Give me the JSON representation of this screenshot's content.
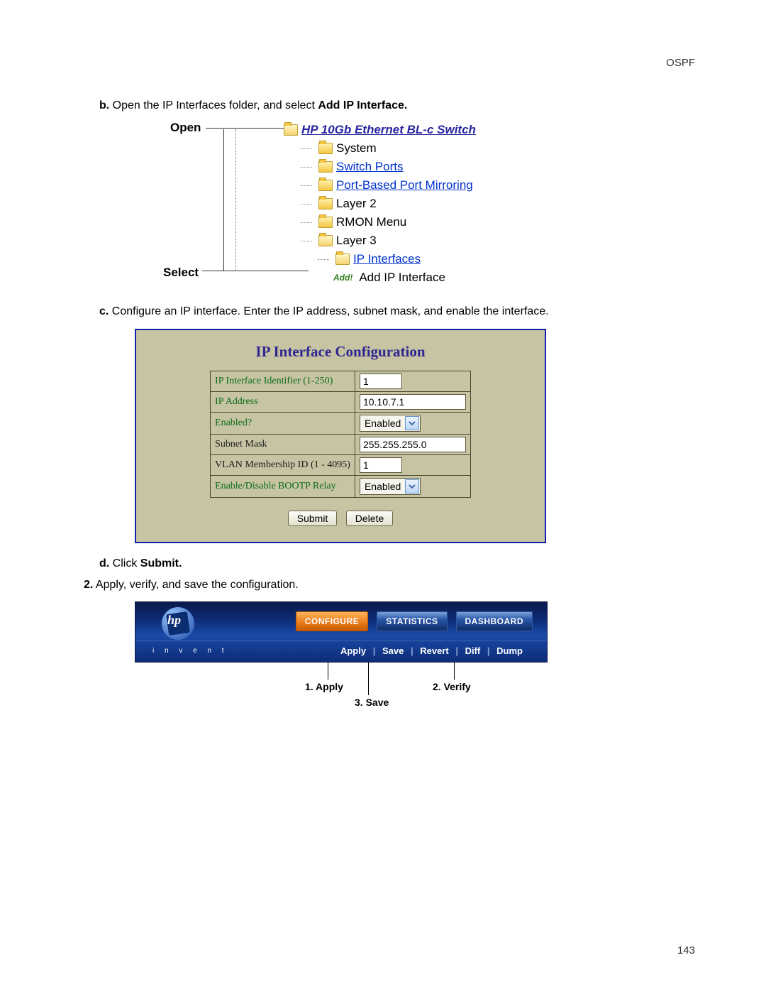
{
  "header": {
    "section": "OSPF"
  },
  "page_number": "143",
  "steps": {
    "b": {
      "bullet": "b.",
      "text_pre": "Open the IP Interfaces folder, and select ",
      "text_bold": "Add IP Interface."
    },
    "c": {
      "bullet": "c.",
      "text": "Configure an IP interface. Enter the IP address, subnet mask, and enable the interface."
    },
    "d": {
      "bullet": "d.",
      "text_pre": "Click ",
      "text_bold": "Submit."
    },
    "s2": {
      "bullet": "2.",
      "text": "Apply, verify, and save the configuration."
    }
  },
  "tree": {
    "label_open": "Open",
    "label_select": "Select",
    "root": "HP 10Gb Ethernet BL-c Switch",
    "items": [
      "System",
      "Switch Ports",
      "Port-Based Port Mirroring",
      "Layer 2",
      "RMON Menu",
      "Layer 3"
    ],
    "sub_link": "IP Interfaces",
    "add_badge": "Add!",
    "add_text": "Add IP Interface"
  },
  "panel": {
    "title": "IP Interface Configuration",
    "rows": {
      "id_label": "IP Interface Identifier (1-250)",
      "id_value": "1",
      "ip_label": "IP Address",
      "ip_value": "10.10.7.1",
      "enabled_label": "Enabled?",
      "enabled_value": "Enabled",
      "mask_label": "Subnet Mask",
      "mask_value": "255.255.255.0",
      "vlan_label": "VLAN Membership ID (1 - 4095)",
      "vlan_value": "1",
      "bootp_label": "Enable/Disable BOOTP Relay",
      "bootp_value": "Enabled"
    },
    "submit": "Submit",
    "delete": "Delete"
  },
  "hpbar": {
    "logo_letters": "hp",
    "invent": "i n v e n t",
    "tabs": {
      "configure": "CONFIGURE",
      "statistics": "STATISTICS",
      "dashboard": "DASHBOARD"
    },
    "sublinks": {
      "apply": "Apply",
      "save": "Save",
      "revert": "Revert",
      "diff": "Diff",
      "dump": "Dump"
    }
  },
  "callouts": {
    "apply": "1. Apply",
    "verify": "2. Verify",
    "save": "3. Save"
  }
}
